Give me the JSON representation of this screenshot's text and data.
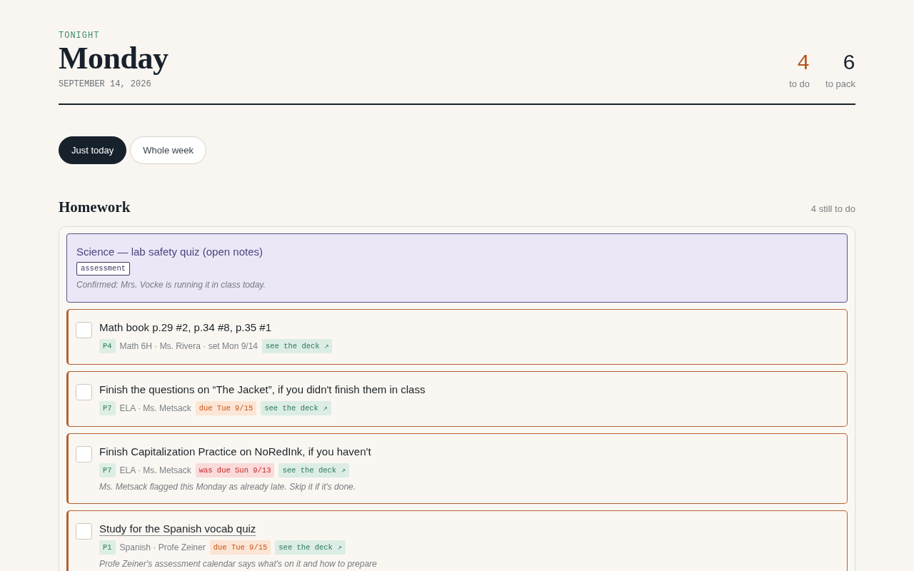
{
  "header": {
    "eyebrow": "TONIGHT",
    "title": "Monday",
    "date": "SEPTEMBER 14, 2026",
    "stats": [
      {
        "value": "4",
        "label": "to do",
        "color": "#b5541c"
      },
      {
        "value": "6",
        "label": "to pack",
        "color": "#18212b"
      }
    ]
  },
  "view_toggle": [
    {
      "label": "Just today",
      "selected": true
    },
    {
      "label": "Whole week",
      "selected": false
    }
  ],
  "homework": {
    "title": "Homework",
    "count": "4 still to do",
    "items": [
      {
        "kind": "assessment",
        "title": "Science — lab safety quiz (open notes)",
        "tag": "assessment",
        "note": "Confirmed: Mrs. Vocke is running it in class today."
      },
      {
        "kind": "task",
        "checked": false,
        "title": "Math book p.29 #2, p.34 #8, p.35 #1",
        "linked": false,
        "period": "P4",
        "meta": "Math 6H · Ms. Rivera · set Mon 9/14",
        "link": "see the deck ↗"
      },
      {
        "kind": "task",
        "checked": false,
        "title": "Finish the questions on “The Jacket”, if you didn't finish them in class",
        "linked": false,
        "period": "P7",
        "meta": "ELA · Ms. Metsack",
        "due": {
          "text": "due Tue 9/15",
          "kind": "upcoming"
        },
        "link": "see the deck ↗"
      },
      {
        "kind": "task",
        "checked": false,
        "title": "Finish Capitalization Practice on NoRedInk, if you haven't",
        "linked": false,
        "period": "P7",
        "meta": "ELA · Ms. Metsack",
        "due": {
          "text": "was due Sun 9/13",
          "kind": "late"
        },
        "link": "see the deck ↗",
        "note": "Ms. Metsack flagged this Monday as already late. Skip it if it's done."
      },
      {
        "kind": "task",
        "checked": false,
        "title": "Study for the Spanish vocab quiz",
        "linked": true,
        "period": "P1",
        "meta": "Spanish · Profe Zeiner",
        "due": {
          "text": "due Tue 9/15",
          "kind": "upcoming"
        },
        "link": "see the deck ↗",
        "note": "Profe Zeiner's assessment calendar says what's on it and how to prepare"
      }
    ]
  }
}
